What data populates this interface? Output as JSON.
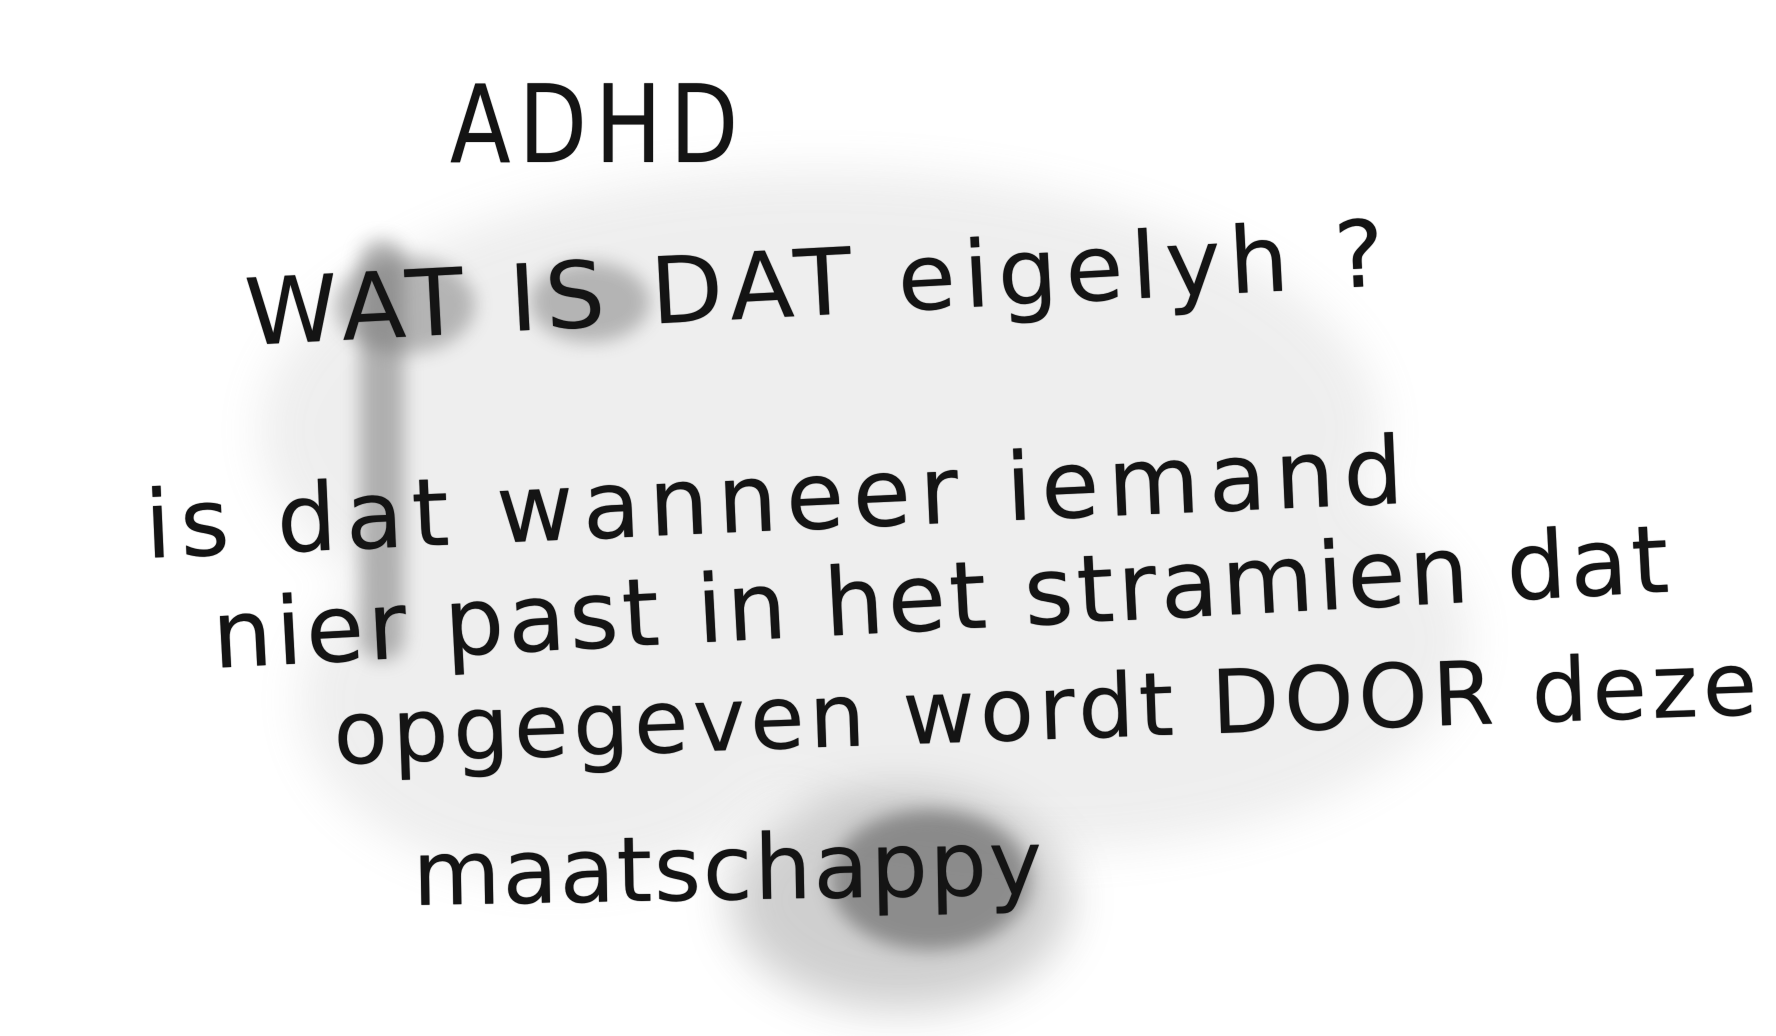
{
  "note": {
    "title": "ADHD",
    "question": "WAT IS DAT eigelyh ?",
    "body_lines": [
      "is dat wanneer iemand",
      "nier past in het stramien dat",
      "opgegeven wordt DOOR deze",
      "maatschappy"
    ]
  },
  "colors": {
    "paper": "#ffffff",
    "ink": "#141414",
    "stain": "#8a8a8a"
  }
}
